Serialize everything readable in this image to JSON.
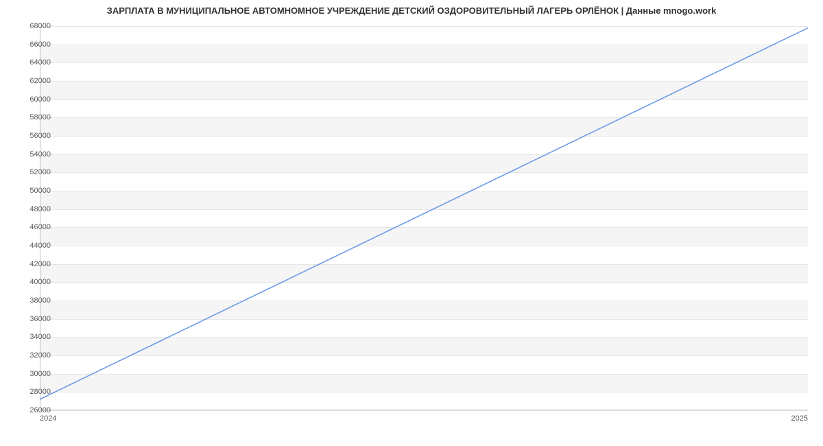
{
  "chart_data": {
    "type": "line",
    "title": "ЗАРПЛАТА В МУНИЦИПАЛЬНОЕ АВТОМНОМНОЕ УЧРЕЖДЕНИЕ ДЕТСКИЙ ОЗДОРОВИТЕЛЬНЫЙ ЛАГЕРЬ ОРЛЁНОК | Данные mnogo.work",
    "xlabel": "",
    "ylabel": "",
    "x_ticks": [
      "2024",
      "2025"
    ],
    "y_ticks": [
      26000,
      28000,
      30000,
      32000,
      34000,
      36000,
      38000,
      40000,
      42000,
      44000,
      46000,
      48000,
      50000,
      52000,
      54000,
      56000,
      58000,
      60000,
      62000,
      64000,
      66000,
      68000
    ],
    "ylim": [
      26000,
      68000
    ],
    "xlim": [
      2024,
      2025
    ],
    "series": [
      {
        "name": "salary",
        "color": "#6b9be8",
        "x": [
          2024,
          2025
        ],
        "values": [
          27200,
          67800
        ]
      }
    ],
    "grid": true
  }
}
